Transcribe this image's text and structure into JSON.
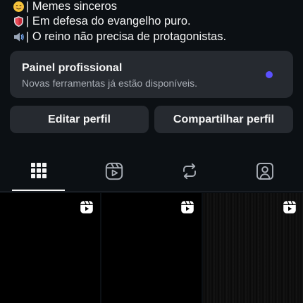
{
  "bio": {
    "lines": [
      {
        "emoji": "smiling-face-emoji",
        "text": "| Memes sinceros"
      },
      {
        "emoji": "shield-emoji",
        "text": "| Em defesa do evangelho puro."
      },
      {
        "emoji": "loudspeaker-emoji",
        "text": "| O reino não precisa de protagonistas."
      }
    ]
  },
  "panel": {
    "title": "Painel profissional",
    "subtitle": "Novas ferramentas já estão disponíveis.",
    "dot_color": "#5b51ff"
  },
  "actions": {
    "edit_label": "Editar perfil",
    "share_label": "Compartilhar perfil"
  },
  "tabs": [
    {
      "icon": "grid-icon",
      "active": true
    },
    {
      "icon": "reels-icon",
      "active": false
    },
    {
      "icon": "repost-icon",
      "active": false
    },
    {
      "icon": "tagged-icon",
      "active": false
    }
  ],
  "posts": [
    {
      "type": "reel",
      "badge_icon": "reels-icon"
    },
    {
      "type": "reel",
      "badge_icon": "reels-icon"
    },
    {
      "type": "reel",
      "badge_icon": "reels-icon"
    }
  ],
  "colors": {
    "background": "#0c1014",
    "surface": "#262a30",
    "text": "#f5f5f5",
    "muted": "#a8adb5",
    "accent": "#5b51ff"
  }
}
